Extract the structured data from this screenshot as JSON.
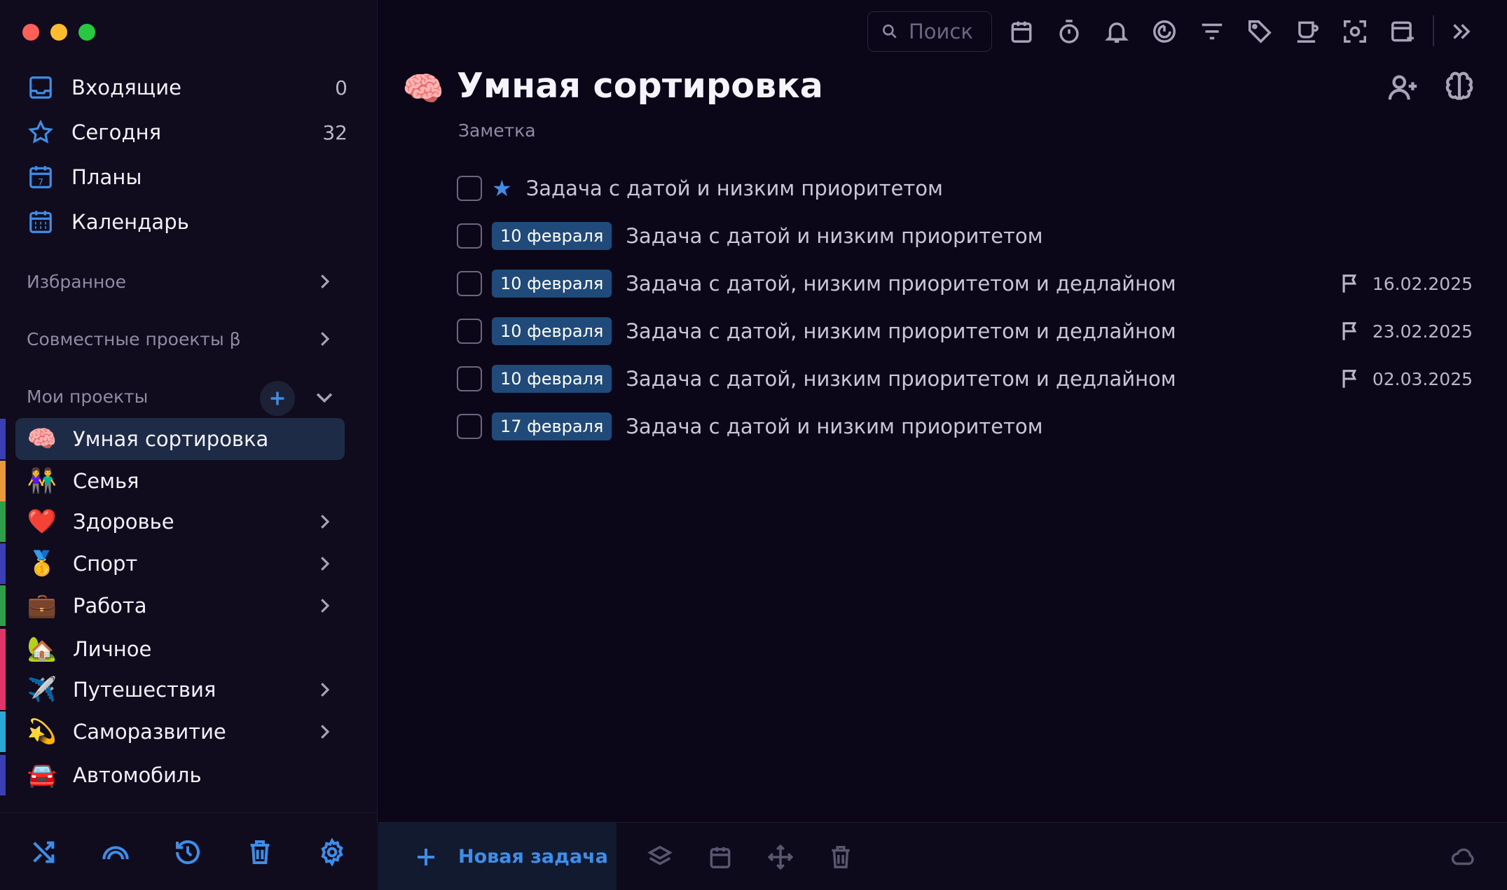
{
  "sidebar": {
    "nav": [
      {
        "label": "Входящие",
        "count": "0",
        "icon": "inbox-icon"
      },
      {
        "label": "Сегодня",
        "count": "32",
        "icon": "star-icon"
      },
      {
        "label": "Планы",
        "count": "",
        "icon": "calendar-day-icon"
      },
      {
        "label": "Календарь",
        "count": "",
        "icon": "calendar-grid-icon"
      }
    ],
    "sections": {
      "favorites": "Избранное",
      "shared": "Совместные проекты β",
      "my_projects": "Мои проекты"
    },
    "projects": [
      {
        "emoji": "🧠",
        "label": "Умная сортировка",
        "color": "#3a3fb5",
        "active": true,
        "chevron": false
      },
      {
        "emoji": "👫",
        "label": "Семья",
        "color": "#e89a3a",
        "active": false,
        "chevron": false
      },
      {
        "emoji": "❤️",
        "label": "Здоровье",
        "color": "#2f9e4a",
        "active": false,
        "chevron": true
      },
      {
        "emoji": "🥇",
        "label": "Спорт",
        "color": "#3a3fb5",
        "active": false,
        "chevron": true
      },
      {
        "emoji": "💼",
        "label": "Работа",
        "color": "#2f9e4a",
        "active": false,
        "chevron": true
      },
      {
        "emoji": "🏡",
        "label": "Личное",
        "color": "#e0356a",
        "active": false,
        "chevron": false
      },
      {
        "emoji": "✈️",
        "label": "Путешествия",
        "color": "#e0356a",
        "active": false,
        "chevron": true
      },
      {
        "emoji": "💫",
        "label": "Саморазвитие",
        "color": "#2aa8d8",
        "active": false,
        "chevron": true
      },
      {
        "emoji": "🚘",
        "label": "Автомобиль",
        "color": "#3a3fb5",
        "active": false,
        "chevron": false
      }
    ],
    "footer_icons": [
      "shuffle-icon",
      "rainbow-icon",
      "history-icon",
      "trash-icon",
      "settings-icon"
    ]
  },
  "toolbar": {
    "search_placeholder": "Поиск",
    "icons": [
      "calendar-icon",
      "timer-icon",
      "bell-icon",
      "focus-icon",
      "filter-icon",
      "tag-icon",
      "coffee-icon",
      "screenshot-icon",
      "add-window-icon",
      "expand-icon"
    ]
  },
  "main": {
    "title_emoji": "🧠",
    "title": "Умная сортировка",
    "subtitle": "Заметка",
    "tasks": [
      {
        "date": "",
        "star": true,
        "text": "Задача с датой и низким приоритетом",
        "deadline": ""
      },
      {
        "date": "10 февраля",
        "star": false,
        "text": "Задача с датой и низким приоритетом",
        "deadline": ""
      },
      {
        "date": "10 февраля",
        "star": false,
        "text": "Задача с датой, низким приоритетом и дедлайном",
        "deadline": "16.02.2025"
      },
      {
        "date": "10 февраля",
        "star": false,
        "text": "Задача с датой, низким приоритетом и дедлайном",
        "deadline": "23.02.2025"
      },
      {
        "date": "10 февраля",
        "star": false,
        "text": "Задача с датой, низким приоритетом и дедлайном",
        "deadline": "02.03.2025"
      },
      {
        "date": "17 февраля",
        "star": false,
        "text": "Задача с датой и низким приоритетом",
        "deadline": ""
      }
    ],
    "new_task_label": "Новая задача"
  },
  "colors": {
    "accent": "#3e8ee8",
    "background": "#0b0718",
    "sidebar": "#100c1e",
    "date_badge": "#1f4a7a"
  }
}
